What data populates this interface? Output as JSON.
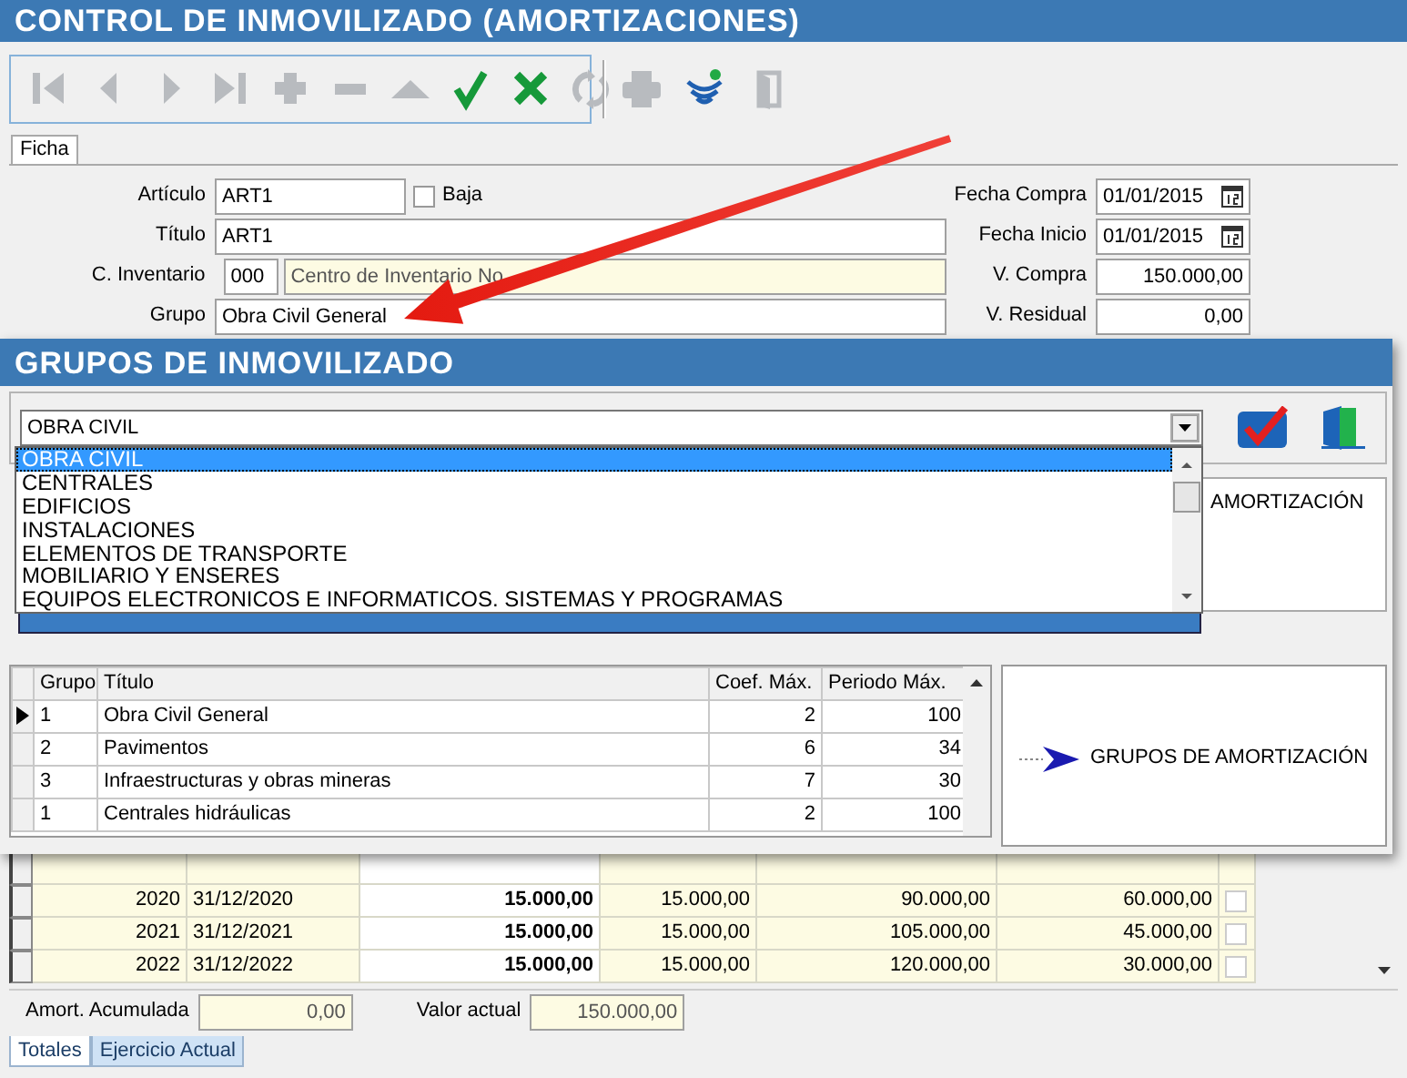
{
  "main_window": {
    "title": "CONTROL DE INMOVILIZADO (AMORTIZACIONES)",
    "toolbar": [
      {
        "kind": "first",
        "disabled": true
      },
      {
        "kind": "prev",
        "disabled": true
      },
      {
        "kind": "next",
        "disabled": true
      },
      {
        "kind": "last",
        "disabled": true
      },
      {
        "kind": "add",
        "disabled": true
      },
      {
        "kind": "remove",
        "disabled": true
      },
      {
        "kind": "up",
        "disabled": true
      },
      {
        "kind": "confirm",
        "disabled": false
      },
      {
        "kind": "cancel",
        "disabled": false
      },
      {
        "kind": "refresh",
        "disabled": true
      }
    ],
    "toolbar_extra": [
      {
        "kind": "print",
        "disabled": true
      },
      {
        "kind": "signal",
        "disabled": false
      },
      {
        "kind": "door",
        "disabled": true
      }
    ],
    "tabs": [
      {
        "label": "Ficha",
        "selected": true
      }
    ],
    "articulo": {
      "label": "Artículo",
      "value": "ART1"
    },
    "baja": {
      "label": "Baja",
      "checked": false
    },
    "titulo": {
      "label": "Título",
      "value": "ART1"
    },
    "inventario": {
      "label": "C. Inventario",
      "code": "000",
      "name": "Centro de Inventario No"
    },
    "grupo": {
      "label": "Grupo",
      "value": "Obra Civil General"
    },
    "right_fields": [
      {
        "label": "Fecha Compra",
        "value": "01/01/2015",
        "kind": "date"
      },
      {
        "label": "Fecha Inicio",
        "value": "01/01/2015",
        "kind": "date"
      },
      {
        "label": "V. Compra",
        "value": "150.000,00",
        "kind": "number"
      },
      {
        "label": "V. Residual",
        "value": "0,00",
        "kind": "number"
      }
    ],
    "schedule_rows": [
      {
        "cells": [
          "2020",
          "31/12/2020",
          "15.000,00",
          "15.000,00",
          "90.000,00",
          "60.000,00"
        ],
        "checked": false
      },
      {
        "cells": [
          "2021",
          "31/12/2021",
          "15.000,00",
          "15.000,00",
          "105.000,00",
          "45.000,00"
        ],
        "checked": false
      },
      {
        "cells": [
          "2022",
          "31/12/2022",
          "15.000,00",
          "15.000,00",
          "120.000,00",
          "30.000,00"
        ],
        "checked": false
      }
    ],
    "totals": [
      {
        "label": "Amort. Acumulada",
        "value": "0,00"
      },
      {
        "label": "Valor actual",
        "value": "150.000,00"
      }
    ],
    "bottom_tabs": [
      {
        "label": "Totales",
        "selected": true
      },
      {
        "label": "Ejercicio Actual",
        "selected": false
      }
    ]
  },
  "dialog": {
    "title": "GRUPOS DE INMOVILIZADO",
    "combo_value": "OBRA CIVIL",
    "dropdown_options": [
      {
        "label": "OBRA CIVIL",
        "selected": true
      },
      {
        "label": "CENTRALES",
        "selected": false
      },
      {
        "label": "EDIFICIOS",
        "selected": false
      },
      {
        "label": "INSTALACIONES",
        "selected": false
      },
      {
        "label": "ELEMENTOS DE TRANSPORTE",
        "selected": false
      },
      {
        "label": "MOBILIARIO Y ENSERES",
        "selected": false
      },
      {
        "label": "EQUIPOS ELECTRONICOS E INFORMATICOS. SISTEMAS Y PROGRAMAS",
        "selected": false
      }
    ],
    "tree_label_behind": "AMORTIZACIÓN",
    "table": {
      "columns": [
        "Grupo",
        "Título",
        "Coef. Máx.",
        "Periodo Máx."
      ],
      "rows": [
        {
          "cells": [
            "1",
            "Obra Civil General",
            "2",
            "100"
          ],
          "selected": true
        },
        {
          "cells": [
            "2",
            "Pavimentos",
            "6",
            "34"
          ],
          "selected": false
        },
        {
          "cells": [
            "3",
            "Infraestructuras y obras mineras",
            "7",
            "30"
          ],
          "selected": false
        },
        {
          "cells": [
            "1",
            "Centrales hidráulicas",
            "2",
            "100"
          ],
          "selected": false
        }
      ]
    },
    "tree": {
      "label": "GRUPOS DE AMORTIZACIÓN"
    }
  }
}
